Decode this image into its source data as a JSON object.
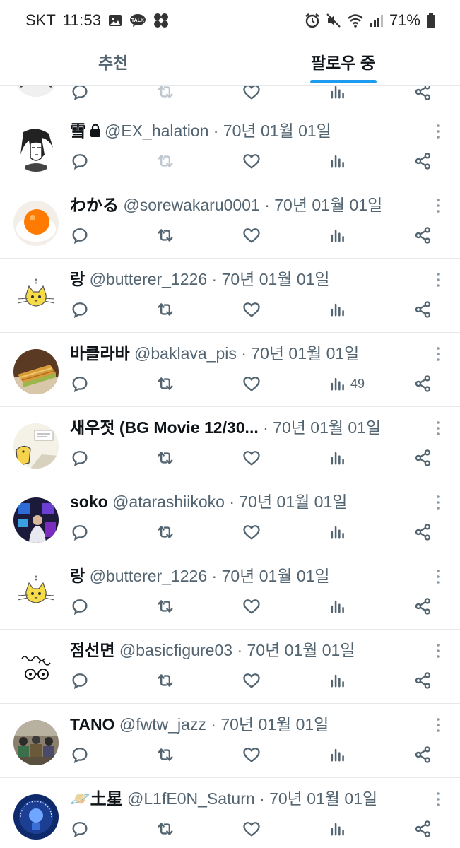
{
  "status_bar": {
    "carrier": "SKT",
    "time": "11:53",
    "battery": "71%"
  },
  "tabs": [
    {
      "label": "추천",
      "active": false
    },
    {
      "label": "팔로우 중",
      "active": true
    }
  ],
  "colors": {
    "accent": "#1d9bf0",
    "text": "#0f1419",
    "secondary": "#536471",
    "divider": "#e6e9ec"
  },
  "posts": [
    {
      "name": "雪",
      "locked": true,
      "handle": "@EX_halation",
      "date": "· 70년 01월 01일",
      "views": "",
      "retweet_disabled": true,
      "avatar": "sketch-portrait"
    },
    {
      "name": "わかる",
      "locked": false,
      "handle": "@sorewakaru0001",
      "date": "· 70년 01월 01일",
      "views": "",
      "retweet_disabled": false,
      "avatar": "egg-yolk"
    },
    {
      "name": "랑",
      "locked": false,
      "handle": "@butterer_1226",
      "date": "· 70년 01월 01일",
      "views": "",
      "retweet_disabled": false,
      "avatar": "yellow-cat"
    },
    {
      "name": "바클라바",
      "locked": false,
      "handle": "@baklava_pis",
      "date": "· 70년 01월 01일",
      "views": "49",
      "retweet_disabled": false,
      "avatar": "baklava"
    },
    {
      "name": "새우젓 (BG Movie 12/30...",
      "locked": false,
      "handle": "",
      "date": "· 70년 01월 01일",
      "views": "",
      "retweet_disabled": false,
      "avatar": "comic-panel"
    },
    {
      "name": "soko",
      "locked": false,
      "handle": "@atarashiikoko",
      "date": "· 70년 01월 01일",
      "views": "",
      "retweet_disabled": false,
      "avatar": "neon-room"
    },
    {
      "name": "랑",
      "locked": false,
      "handle": "@butterer_1226",
      "date": "· 70년 01월 01일",
      "views": "",
      "retweet_disabled": false,
      "avatar": "yellow-cat"
    },
    {
      "name": "점선면",
      "locked": false,
      "handle": "@basicfigure03",
      "date": "· 70년 01월 01일",
      "views": "",
      "retweet_disabled": false,
      "avatar": "glasses-doodle"
    },
    {
      "name": "TANO",
      "locked": false,
      "handle": "@fwtw_jazz",
      "date": "· 70년 01월 01일",
      "views": "",
      "retweet_disabled": false,
      "avatar": "group-photo"
    },
    {
      "name": "🪐土星",
      "locked": false,
      "handle": "@L1fE0N_Saturn",
      "date": "· 70년 01월 01일",
      "views": "",
      "retweet_disabled": false,
      "avatar": "birthday-badge"
    }
  ]
}
